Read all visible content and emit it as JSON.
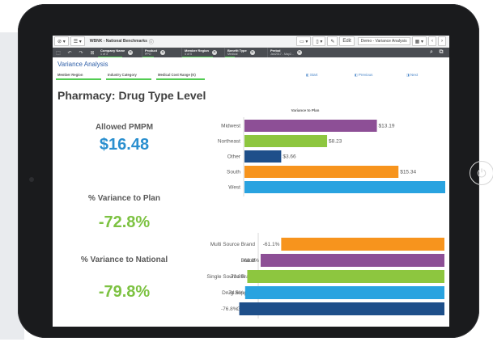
{
  "toolbar": {
    "app_name": "WBNK - National Benchmarks",
    "edit_label": "Edit",
    "sheet_name": "Demo - Variance Analysis"
  },
  "selections": [
    {
      "label": "Company Name",
      "value": "1 of 3"
    },
    {
      "label": "Product",
      "value": "PPO"
    },
    {
      "label": "Member Region",
      "value": "4 of 5"
    },
    {
      "label": "Benefit Type",
      "value": "Medical"
    },
    {
      "label": "Period",
      "value": "Jan2017 - May2..."
    }
  ],
  "header": {
    "title": "Variance Analysis",
    "tabs": [
      "Member Region",
      "Industry Category",
      "Medical Cost Range (K)"
    ],
    "nav": {
      "start": "Start",
      "previous": "Previous",
      "next": "Next"
    }
  },
  "page": {
    "title": "Pharmacy: Drug Type Level"
  },
  "kpis": [
    {
      "label": "Allowed PMPM",
      "value": "$16.48",
      "color": "#2a8fcf"
    },
    {
      "label": "% Variance to Plan",
      "value": "-72.8%",
      "color": "#7dc242"
    },
    {
      "label": "% Variance to National",
      "value": "-79.8%",
      "color": "#7dc242"
    }
  ],
  "chart_data": [
    {
      "type": "bar",
      "orientation": "horizontal",
      "title": "Variance to Plan",
      "categories": [
        "Midwest",
        "Northeast",
        "Other",
        "South",
        "West"
      ],
      "values": [
        13.19,
        8.23,
        3.66,
        15.34,
        20.0
      ],
      "labels": [
        "$13.19",
        "$8.23",
        "$3.66",
        "$15.34",
        ""
      ],
      "colors": [
        "#8d4f96",
        "#8dc63f",
        "#1e4f8a",
        "#f7941d",
        "#29a3e0"
      ],
      "xlim": [
        0,
        20
      ],
      "grid": false
    },
    {
      "type": "bar",
      "orientation": "horizontal",
      "title": "",
      "categories": [
        "Multi Source Brand",
        "Brand",
        "Single Source Brand",
        "Drug Supplies",
        "Generic"
      ],
      "values": [
        -61.1,
        -68.8,
        -73.8,
        -74.6,
        -76.8
      ],
      "labels": [
        "-61.1%",
        "-68.8%",
        "-73.8%",
        "-74.6%",
        "-76.8%"
      ],
      "colors": [
        "#f7941d",
        "#8d4f96",
        "#8dc63f",
        "#29a3e0",
        "#1e4f8a"
      ],
      "xlim": [
        -100,
        0
      ],
      "grid": false
    }
  ],
  "colors": {
    "toolbar_dark": "#4a4d52",
    "accent_green": "#52cc52",
    "title_blue": "#2e5fa8"
  }
}
